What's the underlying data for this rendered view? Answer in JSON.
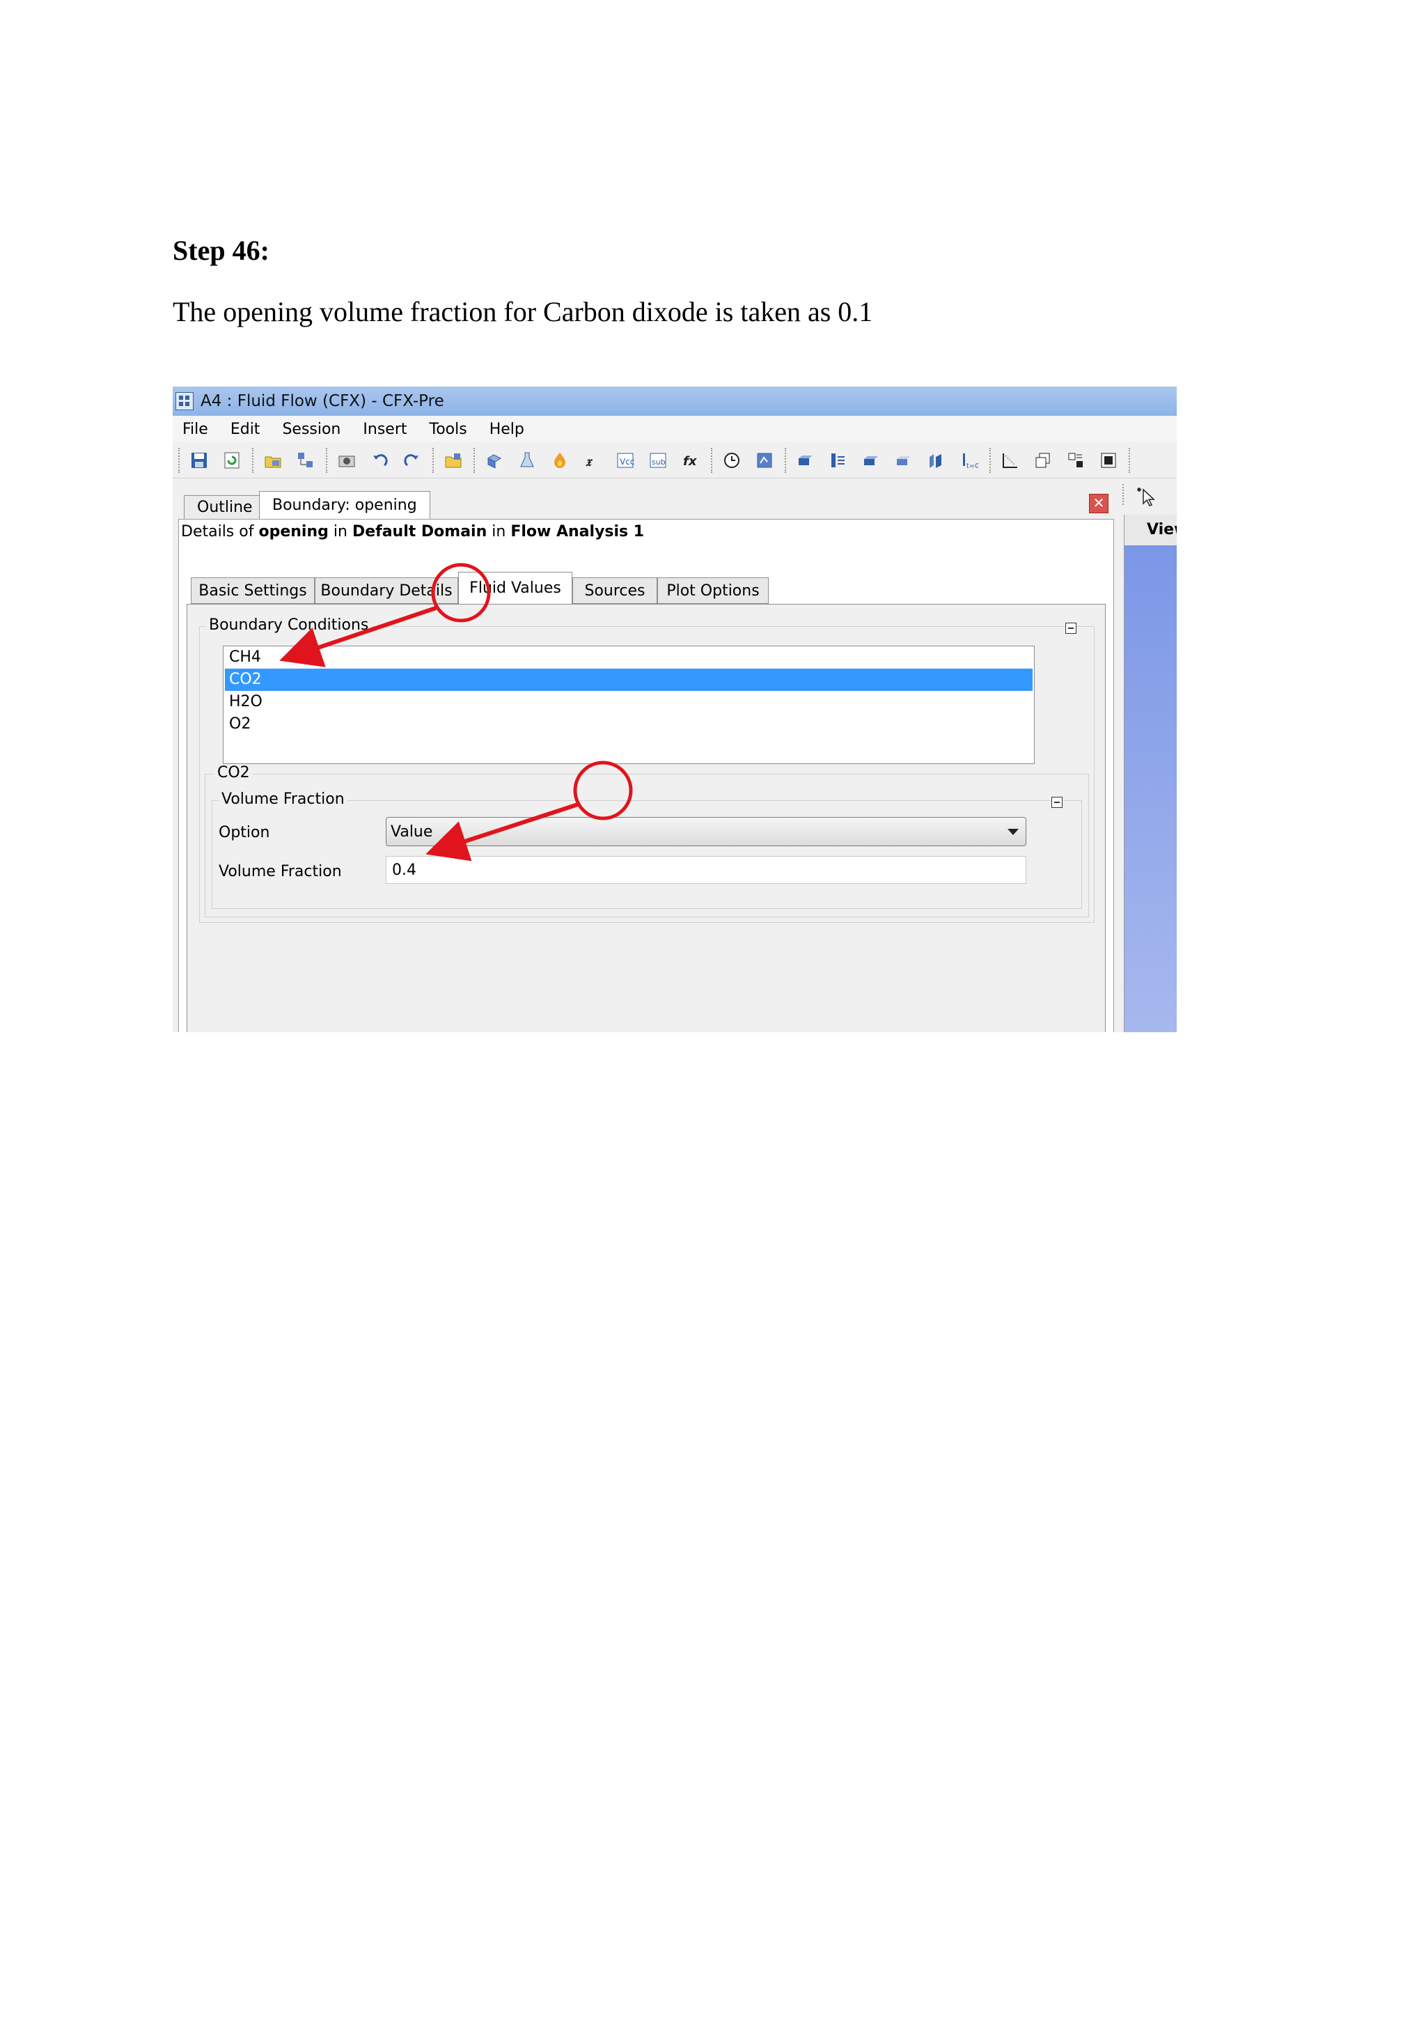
{
  "document": {
    "heading": "Step 46:",
    "description": "The opening volume fraction for Carbon dixode  is taken as 0.1"
  },
  "window": {
    "title": "A4 : Fluid Flow (CFX) - CFX-Pre",
    "menu": [
      "File",
      "Edit",
      "Session",
      "Insert",
      "Tools",
      "Help"
    ],
    "toolbar_icons": [
      "save-icon",
      "refresh-icon",
      "import-mesh-icon",
      "mesh-hierarchy-icon",
      "camera-icon",
      "undo-icon",
      "redo-icon",
      "folder-icon",
      "domain-icon",
      "material-icon",
      "reaction-icon",
      "expression-icon",
      "additional-variable-icon",
      "user-routine-icon",
      "function-icon",
      "clock-icon",
      "solver-control-icon",
      "box-icon",
      "interface-icon",
      "boundary-icon",
      "subdomain-icon",
      "source-point-icon",
      "initialization-icon",
      "output-icon",
      "copy-icon",
      "mesh-adaption-icon",
      "run-icon",
      "pointer-icon"
    ]
  },
  "panel": {
    "tabs": [
      "Outline",
      "Boundary: opening"
    ],
    "details": {
      "prefix": "Details of",
      "object": "opening",
      "in1": "in",
      "domain": "Default Domain",
      "in2": "in",
      "analysis": "Flow Analysis 1"
    },
    "subtabs": [
      "Basic Settings",
      "Boundary Details",
      "Fluid Values",
      "Sources",
      "Plot Options"
    ],
    "boundary_conditions_label": "Boundary Conditions",
    "components": [
      "CH4",
      "CO2",
      "H2O",
      "O2"
    ],
    "selected_component": "CO2",
    "component_group_label": "CO2",
    "volume_fraction_group_label": "Volume Fraction",
    "option_label": "Option",
    "option_value": "Value",
    "volume_fraction_label": "Volume Fraction",
    "volume_fraction_value": "0.4"
  },
  "right_panel": {
    "header": "View"
  },
  "colors": {
    "selection": "#3399ff",
    "annotation": "#e0141c",
    "titlebar": "#a9c7ef"
  }
}
